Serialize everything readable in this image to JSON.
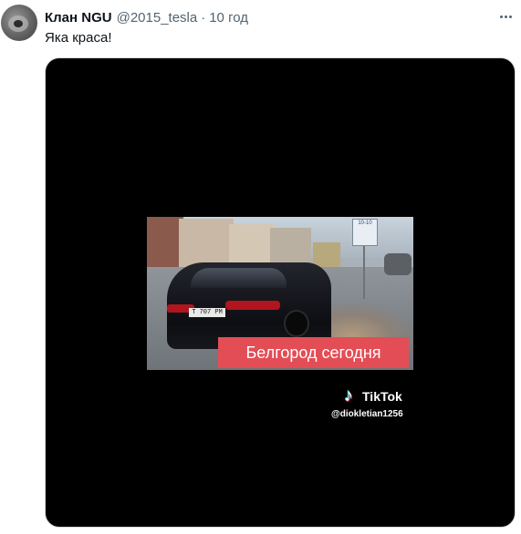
{
  "tweet": {
    "author_name": "Клан NGU",
    "handle": "@2015_tesla",
    "separator": "·",
    "timestamp": "10 год",
    "text": "Яка краса!"
  },
  "media": {
    "video_caption": "Белгород сегодня",
    "license_plate": "Т 707 РМ 31",
    "street_sign": "10-10",
    "watermark_brand": "TikTok",
    "watermark_user": "@diokletian1256"
  },
  "icons": {
    "more": "more-icon",
    "tiktok": "tiktok-logo-icon",
    "avatar": "avatar"
  }
}
